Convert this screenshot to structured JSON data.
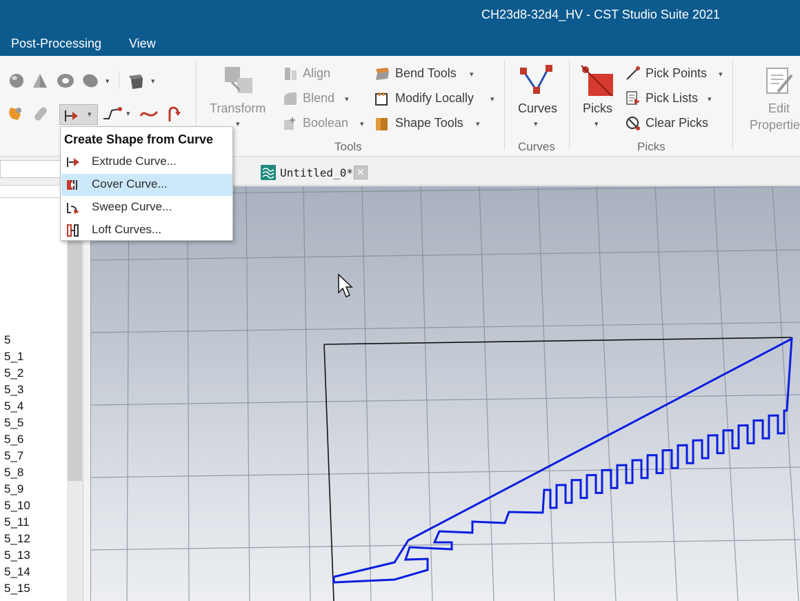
{
  "window": {
    "title": "CH23d8-32d4_HV - CST Studio Suite 2021"
  },
  "menubar": {
    "items": [
      "Post-Processing",
      "View"
    ]
  },
  "ribbon": {
    "tools": {
      "transform_label": "Transform",
      "align_label": "Align",
      "blend_label": "Blend",
      "boolean_label": "Boolean",
      "bend_tools_label": "Bend Tools",
      "modify_locally_label": "Modify Locally",
      "shape_tools_label": "Shape Tools",
      "group_label": "Tools"
    },
    "curves": {
      "button_label": "Curves",
      "group_label": "Curves"
    },
    "picks": {
      "button_label": "Picks",
      "pick_points_label": "Pick Points",
      "pick_lists_label": "Pick Lists",
      "clear_picks_label": "Clear Picks",
      "group_label": "Picks"
    },
    "edit": {
      "line1": "Edit",
      "line2": "Properties"
    }
  },
  "dropdown": {
    "header": "Create Shape from Curve",
    "items": [
      {
        "label": "Extrude Curve...",
        "icon": "extrude-curve-icon",
        "highlighted": false
      },
      {
        "label": "Cover Curve...",
        "icon": "cover-curve-icon",
        "highlighted": true
      },
      {
        "label": "Sweep Curve...",
        "icon": "sweep-curve-icon",
        "highlighted": false
      },
      {
        "label": "Loft Curves...",
        "icon": "loft-curves-icon",
        "highlighted": false
      }
    ]
  },
  "document_tab": {
    "label": "Untitled_0*",
    "close_symbol": "✕"
  },
  "tree": {
    "items": [
      "5",
      "5_1",
      "5_2",
      "5_3",
      "5_4",
      "5_5",
      "5_6",
      "5_7",
      "5_8",
      "5_9",
      "5_10",
      "5_11",
      "5_12",
      "5_13",
      "5_14",
      "5_15"
    ]
  },
  "colors": {
    "title_bar": "#0c5a8e",
    "curve": "#0a1ee0",
    "outline": "#111111",
    "menu_highlight": "#cce8fb"
  }
}
